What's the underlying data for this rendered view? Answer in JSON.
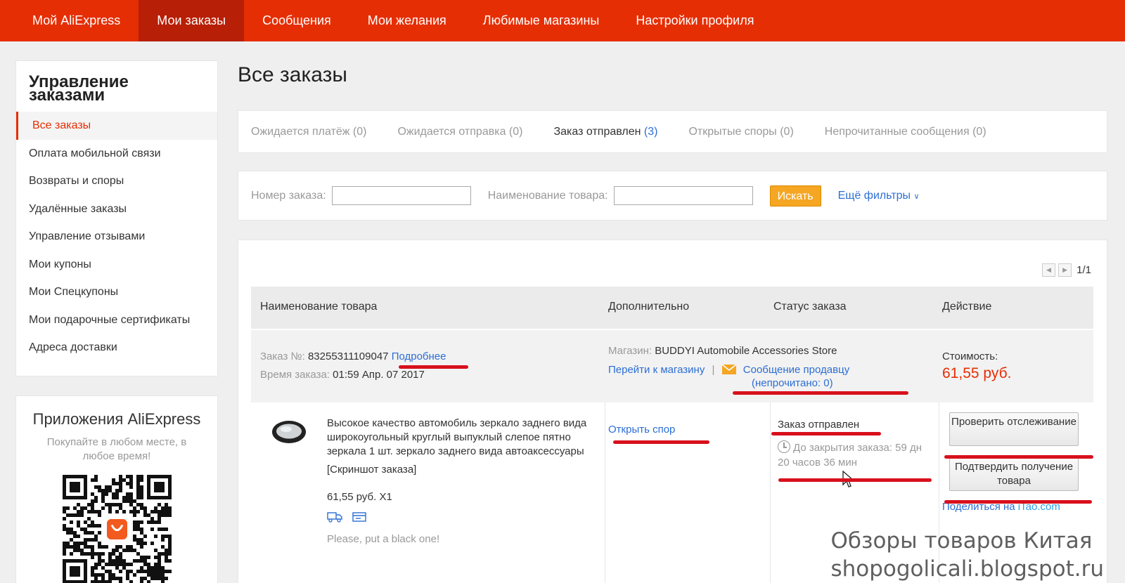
{
  "topnav": {
    "items": [
      "Мой AliExpress",
      "Мои заказы",
      "Сообщения",
      "Мои желания",
      "Любимые магазины",
      "Настройки профиля"
    ],
    "active_index": 1,
    "color": "#e62e04"
  },
  "sidebar": {
    "title": "Управление заказами",
    "items": [
      {
        "label": "Все заказы"
      },
      {
        "label": "Оплата мобильной связи"
      },
      {
        "label": "Возвраты и споры"
      },
      {
        "label": "Удалённые заказы"
      },
      {
        "label": "Управление отзывами"
      },
      {
        "label": "Мои купоны"
      },
      {
        "label": "Мои Спецкупоны"
      },
      {
        "label": "Мои подарочные сертификаты"
      },
      {
        "label": "Адреса доставки"
      }
    ],
    "active_index": 0
  },
  "app_promo": {
    "title": "Приложения AliExpress",
    "subtitle": "Покупайте в любом месте, в любое время!"
  },
  "main": {
    "title": "Все заказы",
    "tabs": [
      {
        "label": "Ожидается платёж",
        "count": "(0)"
      },
      {
        "label": "Ожидается отправка",
        "count": "(0)"
      },
      {
        "label": "Заказ отправлен",
        "count": "(3)"
      },
      {
        "label": "Открытые споры",
        "count": "(0)"
      },
      {
        "label": "Непрочитанные сообщения",
        "count": "(0)"
      }
    ],
    "active_tab_index": 2
  },
  "filters": {
    "order_number_label": "Номер заказа:",
    "order_number_value": "",
    "product_name_label": "Наименование товара:",
    "product_name_value": "",
    "search_button": "Искать",
    "more_filters": "Ещё фильтры"
  },
  "pager": {
    "text": "1/1"
  },
  "table": {
    "columns": [
      "Наименование товара",
      "Дополнительно",
      "Статус заказа",
      "Действие"
    ]
  },
  "order": {
    "number_label": "Заказ №:",
    "number": "83255311109047",
    "details_link": "Подробнее",
    "time_label": "Время заказа:",
    "time": "01:59 Апр. 07 2017",
    "store_label": "Магазин:",
    "store_name": "BUDDYI Automobile Accessories Store",
    "go_to_store": "Перейти к магазину",
    "separator": "|",
    "message_seller": "Сообщение продавцу",
    "unread": "(непрочитано: 0)",
    "cost_label": "Стоимость:",
    "cost": "61,55 руб.",
    "product_title": "Высокое качество автомобиль зеркало заднего вида широкоугольный круглый выпуклый слепое пятно зеркала 1 шт. зеркало заднего вида автоаксессуары",
    "snapshot": "[Скриншот заказа]",
    "price_qty": "61,55 руб. X1",
    "note": "Please, put a black one!",
    "open_dispute": "Открыть спор",
    "status": "Заказ отправлен",
    "countdown": "До закрытия заказа: 59 дн 20 часов 36 мин",
    "check_tracking": "Проверить отслеживание",
    "confirm_receipt": "Подтвердить получение товара",
    "share_prefix": "Поделиться на",
    "share_site": "iTao.com"
  },
  "watermark": {
    "line1": "Обзоры товаров Китая",
    "line2": "shopogolicali.blogspot.ru"
  }
}
